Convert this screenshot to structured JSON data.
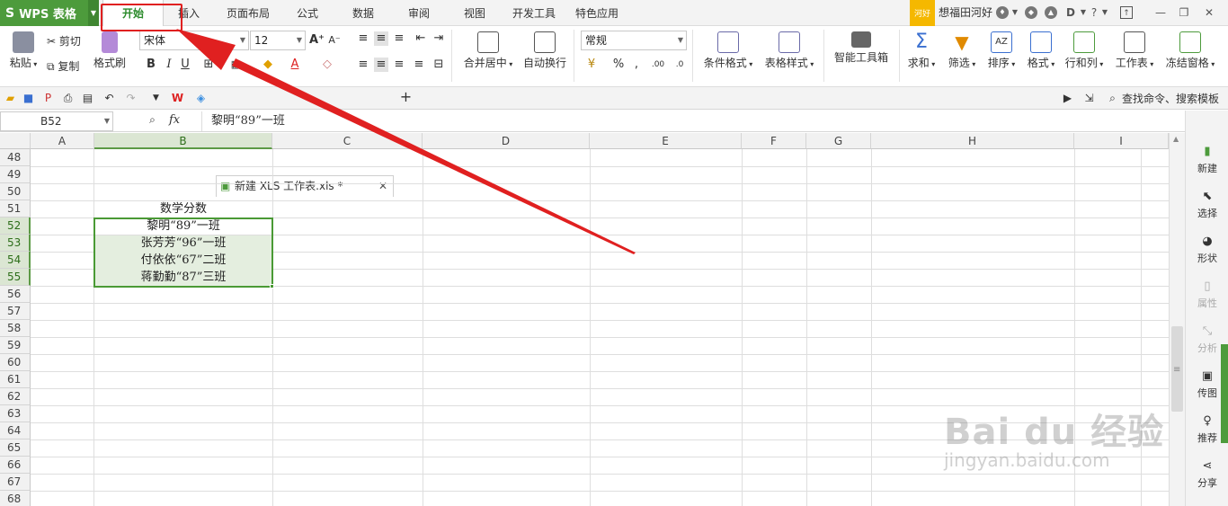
{
  "app": {
    "logo": "WPS 表格",
    "logo_mark": "S"
  },
  "menu_tabs": [
    {
      "label": "开始",
      "active": true
    },
    {
      "label": "插入"
    },
    {
      "label": "页面布局"
    },
    {
      "label": "公式"
    },
    {
      "label": "数据"
    },
    {
      "label": "审阅"
    },
    {
      "label": "视图"
    },
    {
      "label": "开发工具"
    },
    {
      "label": "特色应用"
    }
  ],
  "user": {
    "badge": "河好",
    "name": "想福田河好"
  },
  "ribbon": {
    "paste": "粘贴",
    "cut": "剪切",
    "copy": "复制",
    "format_painter": "格式刷",
    "font_name": "宋体",
    "font_size": "12",
    "merge_center": "合并居中",
    "wrap_text": "自动换行",
    "number_format": "常规",
    "conditional_format": "条件格式",
    "table_style": "表格样式",
    "smart_toolbox": "智能工具箱",
    "sum": "求和",
    "filter": "筛选",
    "sort": "排序",
    "format": "格式",
    "rows_cols": "行和列",
    "worksheet": "工作表",
    "freeze_panes": "冻结窗格"
  },
  "quickbar": {
    "doc_tab": "新建 XLS 工作表.xls *",
    "search": "查找命令、搜索模板"
  },
  "formula": {
    "cell_ref": "B52",
    "fx": "fx",
    "content": "黎明“89”一班"
  },
  "columns": [
    "A",
    "B",
    "C",
    "D",
    "E",
    "F",
    "G",
    "H",
    "I"
  ],
  "rows": [
    "48",
    "49",
    "50",
    "51",
    "52",
    "53",
    "54",
    "55",
    "56",
    "57",
    "58",
    "59",
    "60",
    "61",
    "62",
    "63",
    "64",
    "65",
    "66",
    "67",
    "68"
  ],
  "cells": {
    "B51": "数学分数",
    "B52": "黎明“89”一班",
    "B53": "张芳芳“96”一班",
    "B54": "付依依“67”二班",
    "B55": "蒋勤勤“87”三班"
  },
  "right_panel": [
    {
      "label": "新建",
      "icon": "new-icon"
    },
    {
      "label": "选择",
      "icon": "select-icon"
    },
    {
      "label": "形状",
      "icon": "shape-icon"
    },
    {
      "label": "属性",
      "icon": "property-icon",
      "disabled": true
    },
    {
      "label": "分析",
      "icon": "analysis-icon",
      "disabled": true
    },
    {
      "label": "传图",
      "icon": "upload-image-icon"
    },
    {
      "label": "推荐",
      "icon": "recommend-icon"
    },
    {
      "label": "分享",
      "icon": "share-icon"
    }
  ],
  "watermark": {
    "brand": "Bai du 经验",
    "url": "jingyan.baidu.com"
  },
  "colors": {
    "accent": "#4d9b3c",
    "annotation": "#e02020"
  }
}
